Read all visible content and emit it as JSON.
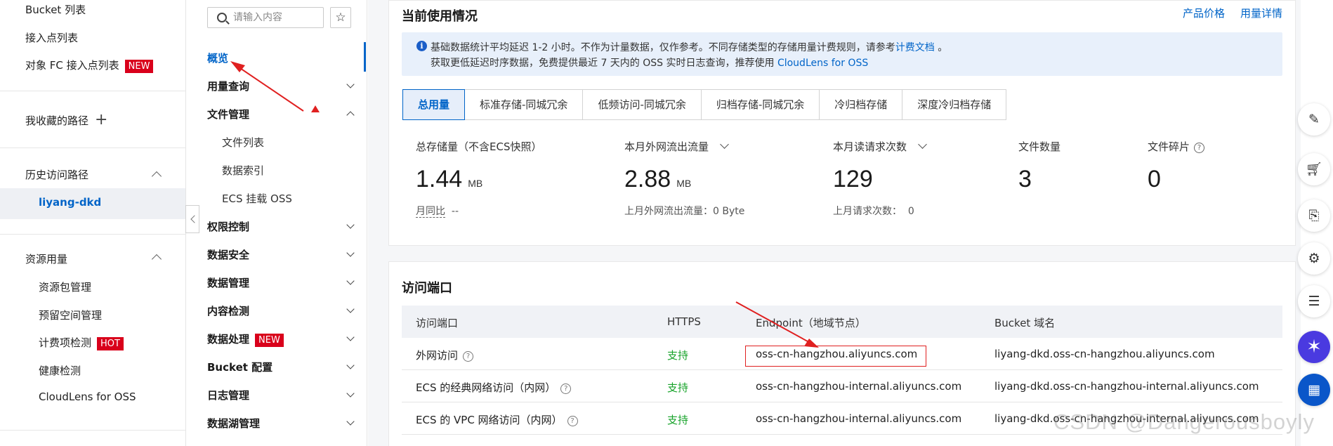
{
  "leftnav": {
    "bucket_list": "Bucket 列表",
    "access_point_list": "接入点列表",
    "fc_access_point_list": "对象 FC 接入点列表",
    "fc_badge": "NEW",
    "favorites": "我收藏的路径",
    "favorites_add_icon": "plus-icon",
    "history": "历史访问路径",
    "history_item": "liyang-dkd",
    "resource_usage": "资源用量",
    "resource_items": [
      {
        "label": "资源包管理"
      },
      {
        "label": "预留空间管理"
      },
      {
        "label": "计费项检测",
        "badge": "HOT"
      },
      {
        "label": "健康检测"
      },
      {
        "label": "CloudLens for OSS"
      }
    ]
  },
  "subnav": {
    "search_placeholder": "请输入内容",
    "items": [
      {
        "label": "概览",
        "active": true
      },
      {
        "label": "用量查询"
      },
      {
        "label": "文件管理"
      },
      {
        "label": "文件列表"
      },
      {
        "label": "数据索引"
      },
      {
        "label": "ECS 挂载 OSS"
      },
      {
        "label": "权限控制"
      },
      {
        "label": "数据安全"
      },
      {
        "label": "数据管理"
      },
      {
        "label": "内容检测"
      },
      {
        "label": "数据处理",
        "badge": "NEW"
      },
      {
        "label": "Bucket 配置"
      },
      {
        "label": "日志管理"
      },
      {
        "label": "数据湖管理"
      }
    ]
  },
  "usage": {
    "title": "当前使用情况",
    "link_price": "产品价格",
    "link_detail": "用量详情",
    "notice_line1_prefix": "基础数据统计平均延迟 1-2 小时。不作为计量数据，仅作参考。不同存储类型的存储用量计费规则，请参考",
    "notice_line1_link": "计费文档",
    "notice_line1_suffix": "。",
    "notice_line2_prefix": "获取更低延迟时序数据，免费提供最近 7 天内的 OSS 实时日志查询，推荐使用",
    "notice_line2_link": "CloudLens for OSS",
    "tabs": [
      "总用量",
      "标准存储-同城冗余",
      "低频访问-同城冗余",
      "归档存储-同城冗余",
      "冷归档存储",
      "深度冷归档存储"
    ],
    "stats": [
      {
        "label": "总存储量（不含ECS快照）",
        "value": "1.44",
        "unit": "MB",
        "sub_label": "月同比",
        "sub_value": "--"
      },
      {
        "label": "本月外网流出流量",
        "value": "2.88",
        "unit": "MB",
        "sub_label": "上月外网流出流量：0 Byte"
      },
      {
        "label": "本月读请求次数",
        "value": "129",
        "unit": "",
        "sub_label": "上月请求次数：",
        "sub_value": "0"
      },
      {
        "label": "文件数量",
        "value": "3"
      },
      {
        "label": "文件碎片",
        "value": "0"
      }
    ]
  },
  "endpoints": {
    "title": "访问端口",
    "columns": [
      "访问端口",
      "HTTPS",
      "Endpoint（地域节点）",
      "Bucket 域名"
    ],
    "rows": [
      {
        "port": "外网访问",
        "https": "支持",
        "endpoint": "oss-cn-hangzhou.aliyuncs.com",
        "bucket_domain": "liyang-dkd.oss-cn-hangzhou.aliyuncs.com"
      },
      {
        "port": "ECS 的经典网络访问（内网）",
        "https": "支持",
        "endpoint": "oss-cn-hangzhou-internal.aliyuncs.com",
        "bucket_domain": "liyang-dkd.oss-cn-hangzhou-internal.aliyuncs.com"
      },
      {
        "port": "ECS 的 VPC 网络访问（内网）",
        "https": "支持",
        "endpoint": "oss-cn-hangzhou-internal.aliyuncs.com",
        "bucket_domain": "liyang-dkd.oss-cn-hangzhou-internal.aliyuncs.com"
      }
    ]
  },
  "rail_icons": [
    "edit-icon",
    "cart-icon",
    "api-icon",
    "settings-icon",
    "chat-icon",
    "ai-assistant-icon",
    "apps-icon"
  ],
  "watermark": "CSDN @Dangerousboyly",
  "colors": {
    "accent": "#0064c8",
    "badge": "#d9001b",
    "success": "#17a32a",
    "annotation": "#e02020"
  }
}
